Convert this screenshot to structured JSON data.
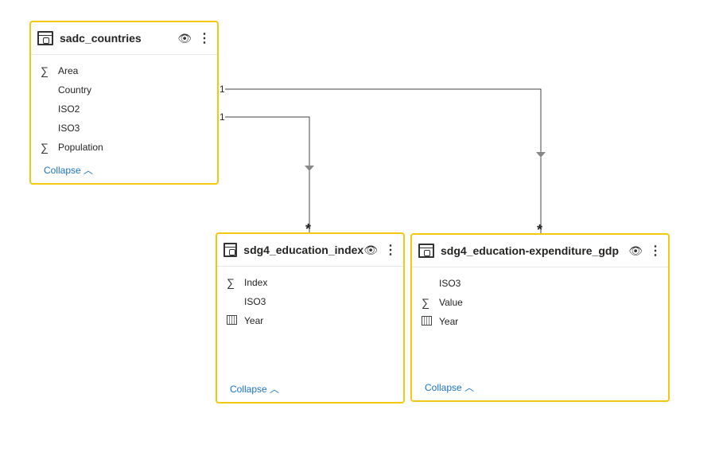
{
  "tables": [
    {
      "name": "sadc_countries",
      "fields": [
        {
          "icon": "sigma",
          "label": "Area"
        },
        {
          "icon": "",
          "label": "Country"
        },
        {
          "icon": "",
          "label": "ISO2"
        },
        {
          "icon": "",
          "label": "ISO3"
        },
        {
          "icon": "sigma",
          "label": "Population"
        }
      ],
      "collapse": "Collapse"
    },
    {
      "name": "sdg4_education_index",
      "fields": [
        {
          "icon": "sigma",
          "label": "Index"
        },
        {
          "icon": "",
          "label": "ISO3"
        },
        {
          "icon": "calendar",
          "label": "Year"
        }
      ],
      "collapse": "Collapse"
    },
    {
      "name": "sdg4_education-expenditure_gdp",
      "fields": [
        {
          "icon": "",
          "label": "ISO3"
        },
        {
          "icon": "sigma",
          "label": "Value"
        },
        {
          "icon": "calendar",
          "label": "Year"
        }
      ],
      "collapse": "Collapse"
    }
  ],
  "relationships": [
    {
      "from": "sadc_countries",
      "to": "sdg4_education_expenditure_gdp",
      "from_card": "1",
      "to_card": "*"
    },
    {
      "from": "sadc_countries",
      "to": "sdg4_education_index",
      "from_card": "1",
      "to_card": "*"
    }
  ],
  "colors": {
    "card_border": "#F2C811",
    "link": "#1a73c9"
  }
}
